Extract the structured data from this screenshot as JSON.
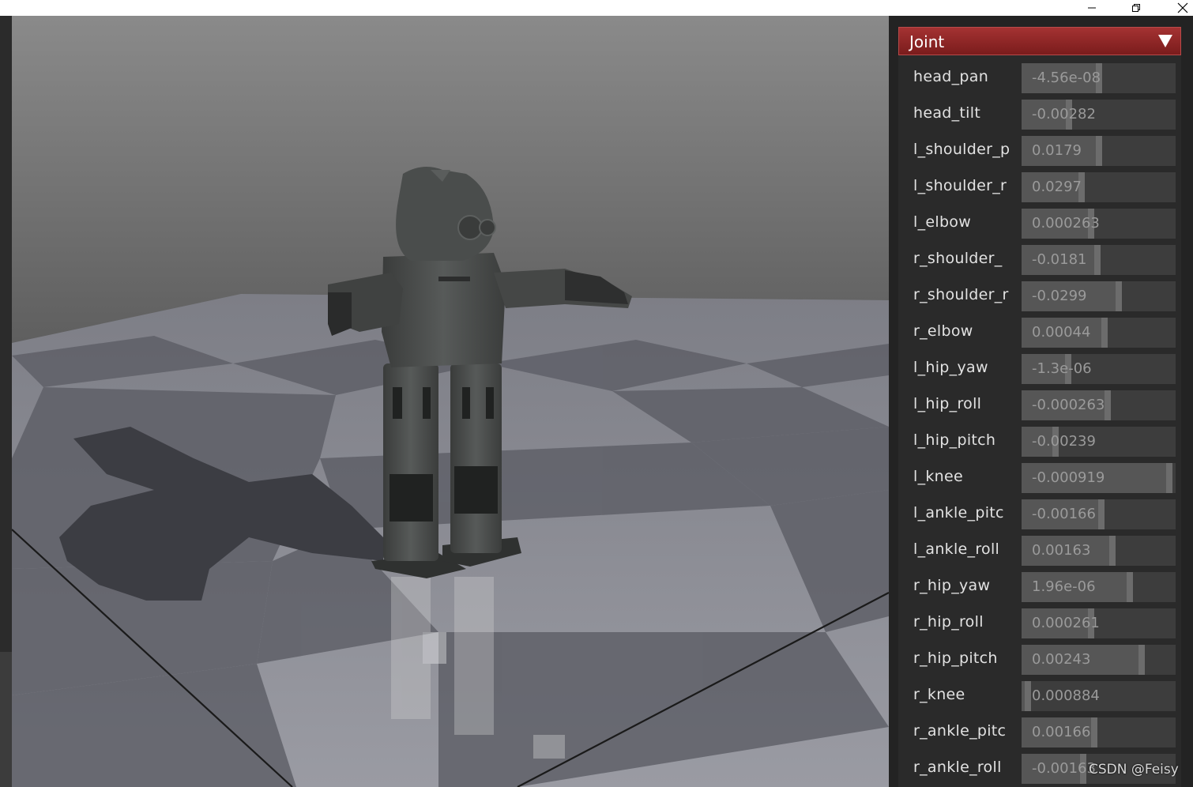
{
  "panel": {
    "header_title": "Joint",
    "joints": [
      {
        "name": "head_pan",
        "value": "-4.56e-08",
        "level": 0.5
      },
      {
        "name": "head_tilt",
        "value": "-0.00282",
        "level": 0.31
      },
      {
        "name": "l_shoulder_p",
        "value": "0.0179",
        "level": 0.5
      },
      {
        "name": "l_shoulder_r",
        "value": "0.0297",
        "level": 0.39
      },
      {
        "name": "l_elbow",
        "value": "0.000263",
        "level": 0.45
      },
      {
        "name": "r_shoulder_",
        "value": "-0.0181",
        "level": 0.49
      },
      {
        "name": "r_shoulder_r",
        "value": "-0.0299",
        "level": 0.63
      },
      {
        "name": "r_elbow",
        "value": "0.00044",
        "level": 0.54
      },
      {
        "name": "l_hip_yaw",
        "value": "-1.3e-06",
        "level": 0.3
      },
      {
        "name": "l_hip_roll",
        "value": "-0.000263",
        "level": 0.56
      },
      {
        "name": "l_hip_pitch",
        "value": "-0.00239",
        "level": 0.22
      },
      {
        "name": "l_knee",
        "value": "-0.000919",
        "level": 0.96
      },
      {
        "name": "l_ankle_pitc",
        "value": "-0.00166",
        "level": 0.52
      },
      {
        "name": "l_ankle_roll",
        "value": "0.00163",
        "level": 0.59
      },
      {
        "name": "r_hip_yaw",
        "value": "1.96e-06",
        "level": 0.7
      },
      {
        "name": "r_hip_roll",
        "value": "0.000261",
        "level": 0.45
      },
      {
        "name": "r_hip_pitch",
        "value": "0.00243",
        "level": 0.78
      },
      {
        "name": "r_knee",
        "value": "0.000884",
        "level": 0.04
      },
      {
        "name": "r_ankle_pitc",
        "value": "0.00166",
        "level": 0.47
      },
      {
        "name": "r_ankle_roll",
        "value": "-0.00163",
        "level": 0.4
      }
    ]
  },
  "watermark": "CSDN @Feisy",
  "colors": {
    "header_red": "#8c2525",
    "slider_fill": "#565656",
    "slider_track": "#3d3d3d",
    "robot_body": "#4a4d4c"
  },
  "icons": {
    "minimize": "minimize-icon",
    "restore": "restore-icon",
    "close": "close-icon",
    "collapse": "triangle-down-icon"
  }
}
